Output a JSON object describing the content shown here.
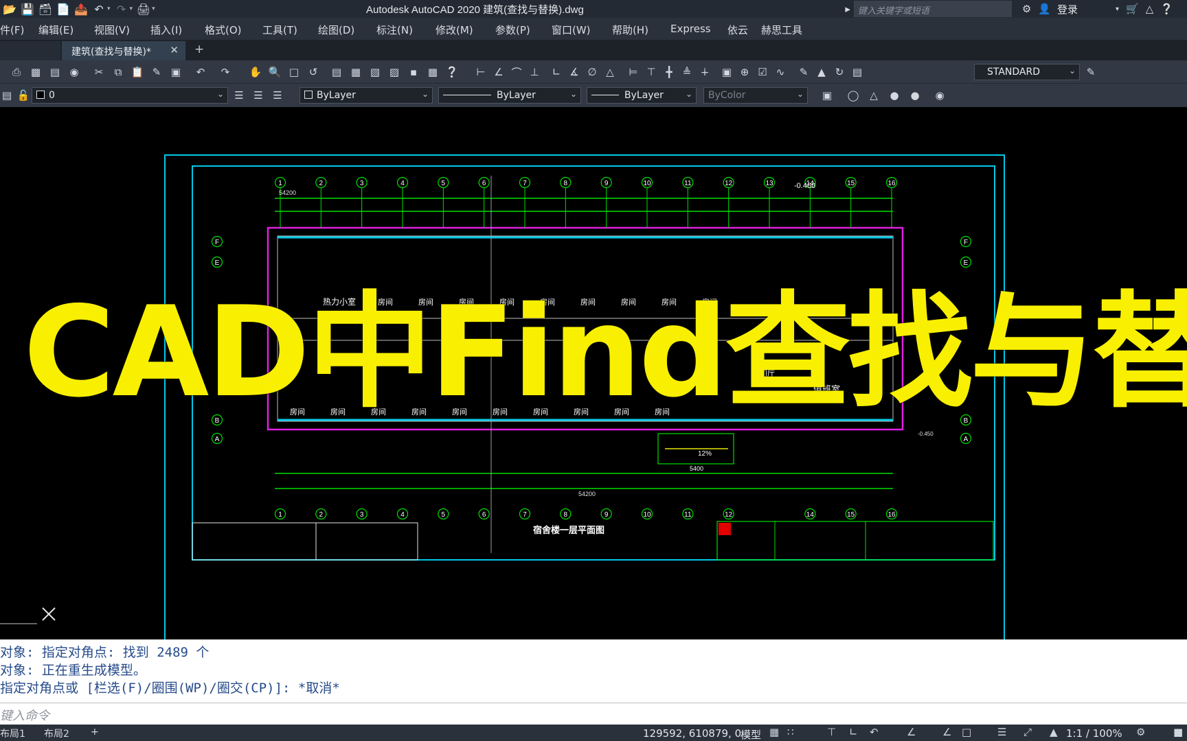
{
  "titlebar": {
    "app_title": "Autodesk AutoCAD 2020    建筑(查找与替换).dwg",
    "search_placeholder": "键入关键字或短语",
    "login": "登录"
  },
  "menu": [
    "件(F)",
    "编辑(E)",
    "视图(V)",
    "插入(I)",
    "格式(O)",
    "工具(T)",
    "绘图(D)",
    "标注(N)",
    "修改(M)",
    "参数(P)",
    "窗口(W)",
    "帮助(H)",
    "Express",
    "依云",
    "赫思工具"
  ],
  "tabs": {
    "document": "建筑(查找与替换)*",
    "close": "✕",
    "add": "+"
  },
  "toolbar": {
    "text_style": "STANDARD",
    "layer": "0",
    "color": "ByLayer",
    "linetype": "ByLayer",
    "lineweight": "ByLayer",
    "plotstyle": "ByColor"
  },
  "drawing": {
    "axis_top": [
      "1",
      "2",
      "3",
      "4",
      "5",
      "6",
      "7",
      "8",
      "9",
      "10",
      "11",
      "12",
      "13",
      "14",
      "15",
      "16"
    ],
    "axis_bottom": [
      "1",
      "2",
      "3",
      "4",
      "5",
      "6",
      "7",
      "8",
      "9",
      "10",
      "11",
      "12",
      "14",
      "15",
      "16"
    ],
    "axis_rows": [
      "F",
      "E",
      "B",
      "A"
    ],
    "total_dim": "54200",
    "total_dim_bottom": "54200",
    "level_top": "-0.460",
    "level_bottom": "-0.450",
    "room_hot": "热力小室",
    "room": "房间",
    "plan_title": "宿舍楼一层平面图",
    "slope": "12%",
    "ramp_dim": "5400",
    "guard_room": "值班室",
    "hall": "门厅"
  },
  "overlay_title": "CAD中Find查找与替换",
  "command_history": [
    "对象: 指定对角点: 找到 2489 个",
    "对象:   正在重生成模型。",
    " 指定对角点或 [栏选(F)/圈围(WP)/圈交(CP)]: *取消*"
  ],
  "command_placeholder": "键入命令",
  "statusbar": {
    "layout1": "布局1",
    "layout2": "布局2",
    "add": "+",
    "coords": "129592, 610879, 0",
    "model": "模型",
    "scale": "1:1 / 100%"
  },
  "colors": {
    "overlay_yellow": "#f8f000",
    "frame_cyan": "#00c8e6",
    "dim_green": "#00e000",
    "wall_magenta": "#e020e0",
    "command_blue": "#274b8a"
  }
}
